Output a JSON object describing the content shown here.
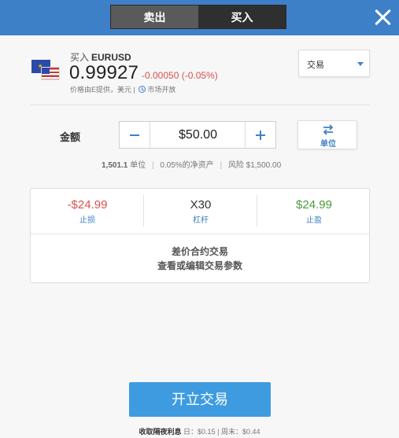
{
  "header": {
    "sell_tab": "卖出",
    "buy_tab": "买入"
  },
  "instrument": {
    "action": "买入",
    "symbol": "EURUSD",
    "price": "0.99927",
    "change": "-0.00050 (-0.05%)",
    "provider": "价格由E提供，美元",
    "separator": "|",
    "market_status": "市场开放"
  },
  "order_type": {
    "selected": "交易"
  },
  "amount": {
    "label": "金额",
    "value": "$50.00",
    "units_label": "单位"
  },
  "info": {
    "units_value": "1,501.1",
    "units_label": "单位",
    "equity": "0.05%的净资产",
    "risk": "风险 $1,500.00"
  },
  "params": {
    "stop_loss_value": "-$24.99",
    "stop_loss_label": "止损",
    "leverage_value": "X30",
    "leverage_label": "杠杆",
    "take_profit_value": "$24.99",
    "take_profit_label": "止盈",
    "cfd_title": "差价合约交易",
    "cfd_subtitle": "查看或编辑交易参数"
  },
  "action": {
    "open_trade": "开立交易"
  },
  "footer": {
    "label": "收取隔夜利息",
    "daily": "日：$0.15",
    "weekend": "周末：$0.44"
  },
  "colors": {
    "accent": "#3e80c8",
    "button": "#3e9be0",
    "negative": "#d9534f",
    "positive": "#4a9a3a"
  }
}
